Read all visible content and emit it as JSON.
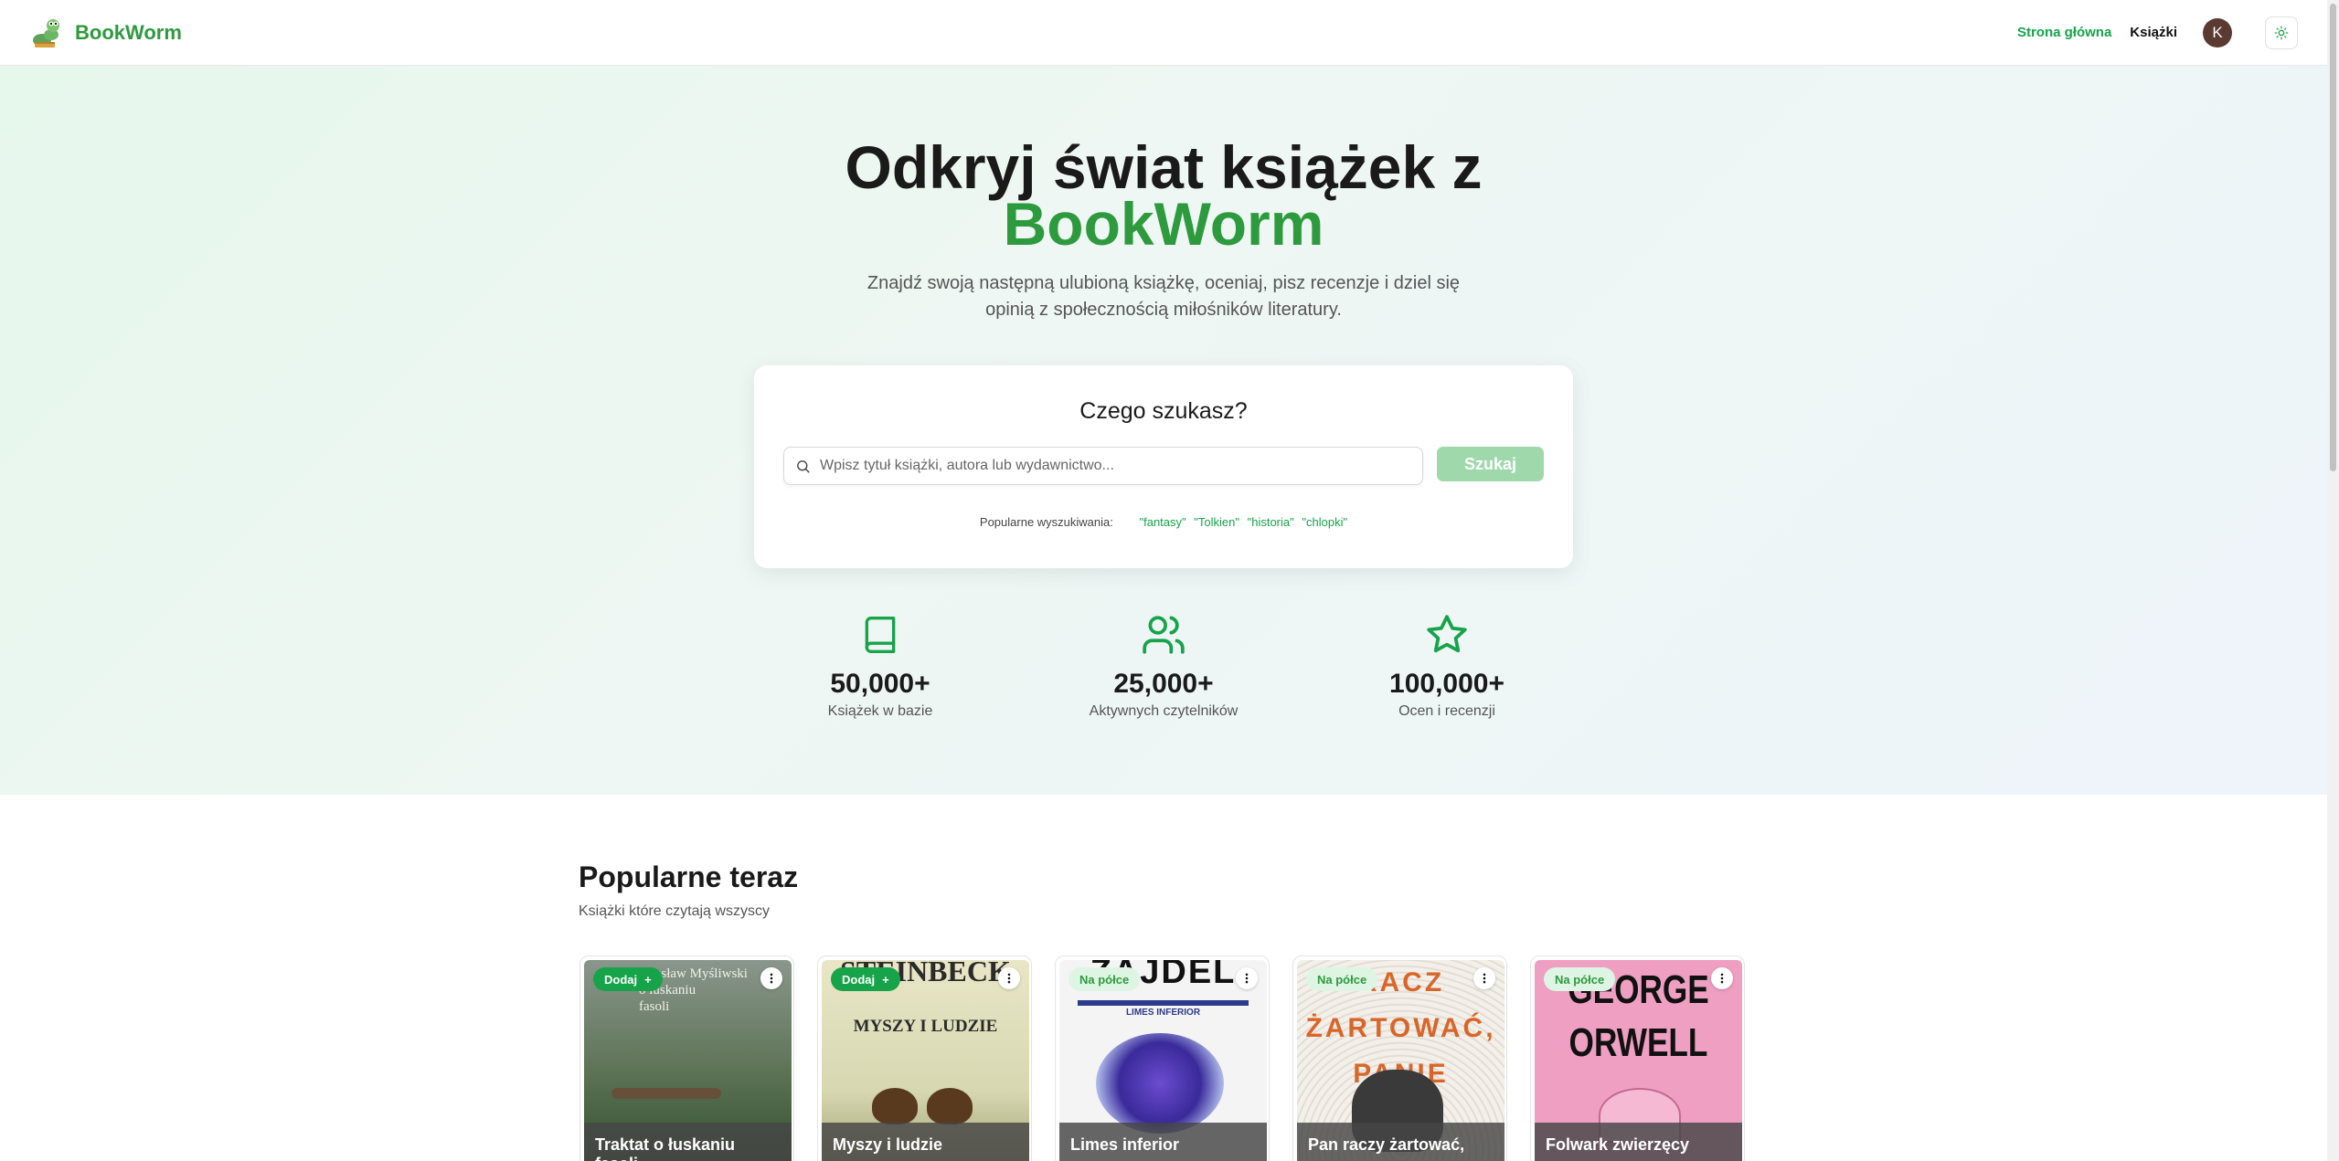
{
  "header": {
    "brand": "BookWorm",
    "nav": {
      "home": "Strona główna",
      "books": "Książki"
    },
    "avatar_initial": "K"
  },
  "hero": {
    "title_line1": "Odkryj świat książek z",
    "title_brand": "BookWorm",
    "subtitle_line1": "Znajdź swoją następną ulubioną książkę, oceniaj, pisz recenzje i dziel się",
    "subtitle_line2": "opinią z społecznością miłośników literatury."
  },
  "search": {
    "heading": "Czego szukasz?",
    "placeholder": "Wpisz tytuł książki, autora lub wydawnictwo...",
    "button": "Szukaj",
    "popular_label": "Popularne wyszukiwania:",
    "popular_tags": [
      "\"fantasy\"",
      "\"Tolkien\"",
      "\"historia\"",
      "\"chlopki\""
    ]
  },
  "stats": [
    {
      "icon": "book-icon",
      "value": "50,000+",
      "label": "Książek w bazie"
    },
    {
      "icon": "users-icon",
      "value": "25,000+",
      "label": "Aktywnych czytelników"
    },
    {
      "icon": "star-icon",
      "value": "100,000+",
      "label": "Ocen i recenzji"
    }
  ],
  "popular": {
    "title": "Popularne teraz",
    "subtitle": "Książki które czytają wszyscy",
    "books": [
      {
        "title": "Traktat o łuskaniu fasoli",
        "badge": "Dodaj",
        "cover_text": "Wiesław Myśliwski\no łuskaniu\nfasoli"
      },
      {
        "title": "Myszy i ludzie",
        "badge": "Dodaj",
        "cover_top": "STEINBECK",
        "cover_text": "MYSZY I LUDZIE"
      },
      {
        "title": "Limes inferior",
        "badge": "Na półce",
        "cover_top": "ZAJDEL",
        "cover_text": "LIMES INFERIOR"
      },
      {
        "title": "Pan raczy żartować,",
        "badge": "Na półce",
        "cover_text": "RACZ\nŻARTOWAĆ,\nPANIE"
      },
      {
        "title": "Folwark zwierzęcy",
        "badge": "Na półce",
        "cover_text": "GEORGE\nORWELL"
      }
    ]
  },
  "colors": {
    "accent": "#16a34a",
    "brand": "#2e9a3e",
    "search_button": "#9fd9ab"
  }
}
